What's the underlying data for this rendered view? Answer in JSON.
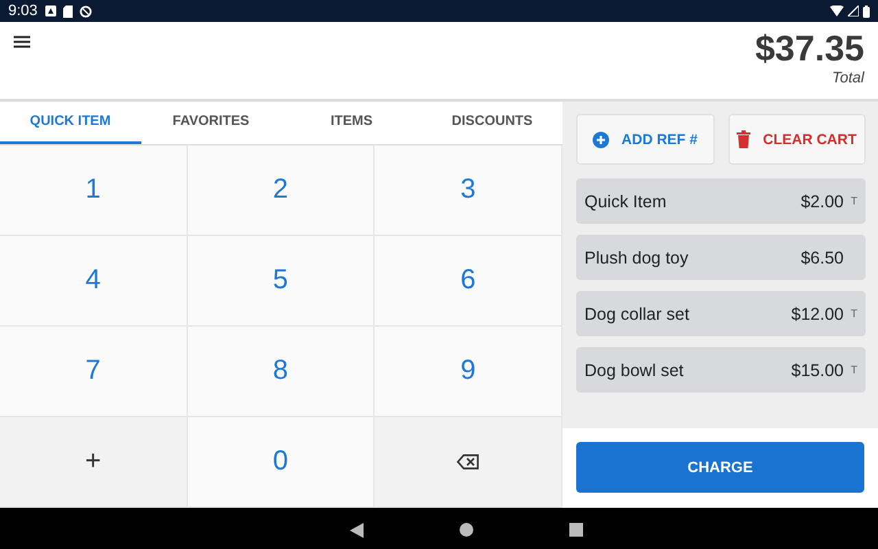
{
  "status_bar": {
    "time": "9:03"
  },
  "header": {
    "total": "$37.35",
    "total_label": "Total"
  },
  "tabs": [
    {
      "label": "QUICK ITEM",
      "selected": true
    },
    {
      "label": "FAVORITES",
      "selected": false
    },
    {
      "label": "ITEMS",
      "selected": false
    },
    {
      "label": "DISCOUNTS",
      "selected": false
    }
  ],
  "keypad": [
    {
      "kind": "digit",
      "label": "1"
    },
    {
      "kind": "digit",
      "label": "2"
    },
    {
      "kind": "digit",
      "label": "3"
    },
    {
      "kind": "digit",
      "label": "4"
    },
    {
      "kind": "digit",
      "label": "5"
    },
    {
      "kind": "digit",
      "label": "6"
    },
    {
      "kind": "digit",
      "label": "7"
    },
    {
      "kind": "digit",
      "label": "8"
    },
    {
      "kind": "digit",
      "label": "9"
    },
    {
      "kind": "plus",
      "label": "+"
    },
    {
      "kind": "digit",
      "label": "0"
    },
    {
      "kind": "backspace"
    }
  ],
  "actions": [
    {
      "kind": "add",
      "label": "ADD REF #"
    },
    {
      "kind": "clear",
      "label": "CLEAR CART"
    }
  ],
  "cart": [
    {
      "name": "Quick Item",
      "price": "$2.00",
      "tax_mark": "T"
    },
    {
      "name": "Plush dog toy",
      "price": "$6.50"
    },
    {
      "name": "Dog collar set",
      "price": "$12.00",
      "tax_mark": "T"
    },
    {
      "name": "Dog bowl set",
      "price": "$15.00",
      "tax_mark": "T"
    }
  ],
  "charge_button": "CHARGE"
}
